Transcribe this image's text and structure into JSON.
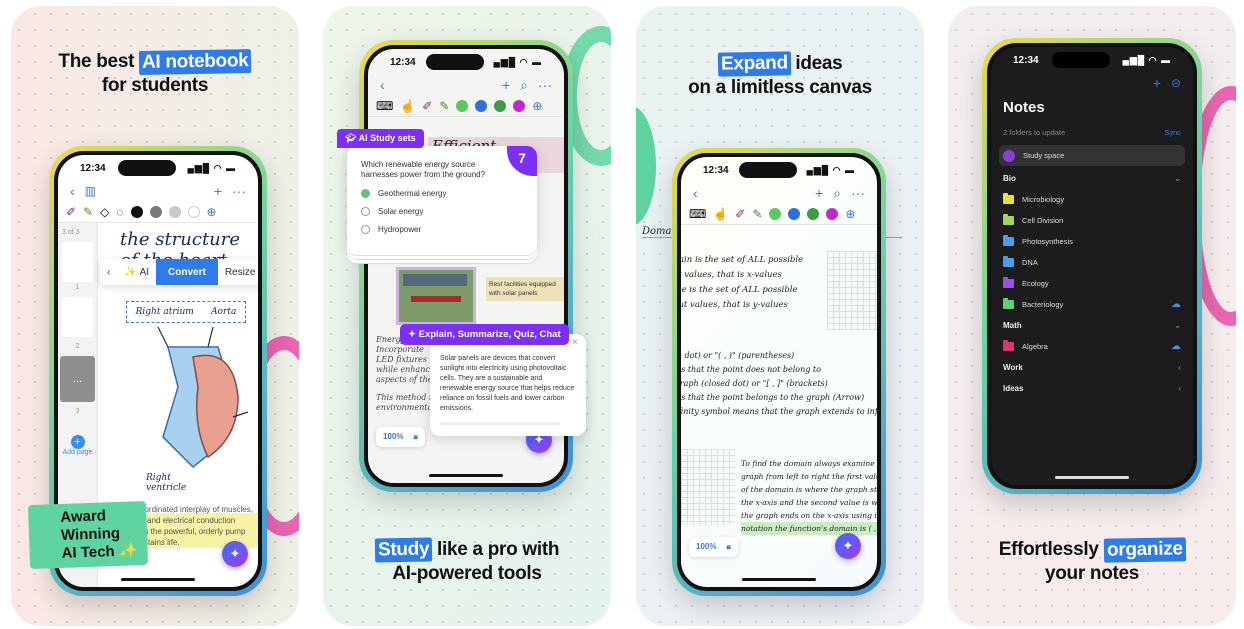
{
  "cards": [
    {
      "headline": {
        "plain_before": "The best ",
        "highlight": "AI notebook",
        "line2": "for students"
      },
      "phone": {
        "time": "12:34",
        "status_icons": "▄▆█ ◠ ▬",
        "nav": {
          "back": "‹",
          "sidebar": "▥",
          "add": "+",
          "more": "···"
        },
        "colors": [
          "#111111",
          "#7a7a7a",
          "#c8c8c8",
          "#ffffff"
        ],
        "page_indicator": "3 of 3",
        "thumb_labels": [
          "1",
          "2",
          "3"
        ],
        "add_page": "Add page",
        "context_menu": {
          "back": "‹",
          "ai": "AI",
          "convert": "Convert",
          "resize": "Resize"
        },
        "note_title": "the structure of the heart",
        "labels": [
          "Right atrium",
          "Aorta",
          "Right ventricle"
        ],
        "body_text": "The coordinated interplay of muscles, valves, and electrical conduction ensures the powerful, orderly pump that sustains life."
      },
      "award": [
        "Award",
        "Winning",
        "AI Tech ✨"
      ]
    },
    {
      "headline": {
        "highlight": "Study",
        "plain_after": " like a pro with",
        "line2": "AI-powered tools"
      },
      "phone": {
        "time": "12:34",
        "status_icons": "▄▆█ ◠ ▬",
        "nav": {
          "back": "‹",
          "add": "+",
          "search": "⌕",
          "more": "···"
        },
        "colors": [
          "#5cc85a",
          "#2f6fe0",
          "#3f9a47",
          "#c02ac8"
        ],
        "note_title": "Efficient Landscaping",
        "sticky_note": "Rest facilities equipped with solar panels",
        "hand_lines": [
          "Energy-",
          "Incorporate",
          "LED fixtures",
          "while enhancing",
          "aspects of the",
          "This method is",
          "environmental"
        ],
        "zoom_level": "100%"
      },
      "study_set": {
        "tag": "AI Study sets",
        "count": "7",
        "question": "Which renewable energy source harnesses power from the ground?",
        "options": [
          {
            "label": "Geothermal energy",
            "selected": true
          },
          {
            "label": "Solar energy",
            "selected": false
          },
          {
            "label": "Hydropower",
            "selected": false
          }
        ]
      },
      "ai_panel": {
        "tag": "Explain, Summarize, Quiz, Chat",
        "close": "×",
        "text": "Solar panels are devices that convert sunlight into electricity using photovoltaic cells. They are a sustainable and renewable energy source that helps reduce reliance on fossil fuels and lower carbon emissions."
      }
    },
    {
      "headline": {
        "highlight": "Expand",
        "plain_after": " ideas",
        "line2": "on a limitless canvas"
      },
      "phone": {
        "time": "12:34",
        "status_icons": "▄▆█ ◠ ▬",
        "nav": {
          "back": "‹",
          "add": "+",
          "search": "⌕",
          "more": "···"
        },
        "colors": [
          "#5cc85a",
          "#2f6fe0",
          "#3f9a47",
          "#c02ac8"
        ],
        "note_title": "Domain and Range of a Function's graph",
        "lines_a": [
          "Domain is the set of ALL possible",
          "input values, that is x-values",
          "Range is the set of ALL possible",
          "output values, that is y-values"
        ],
        "lines_b": [
          "(open dot) or \"( , )\" (parentheses)",
          "means that the point does not belong to",
          "the graph (closed dot) or \"[ , ]\" (brackets)",
          "means that the point belongs to the graph (Arrow)",
          "or infinity symbol means that the graph extends to infinity"
        ],
        "lines_c": [
          "To find the domain always examine your",
          "graph from left to right the first value",
          "of the domain is where the graph starts",
          "the x-axis and the second value is where",
          "the graph ends on the x-axis using interval",
          "notation the function's domain is ( , )"
        ],
        "zoom_level": "100%"
      }
    },
    {
      "headline": {
        "plain_before": "Effortlessly ",
        "highlight": "organize",
        "line2": "your notes"
      },
      "phone": {
        "time": "12:34",
        "status_icons": "▄▆█ ◠ ▬",
        "title": "Notes",
        "sync_hint": "2 folders to update",
        "sync_label": "Sync",
        "study_space": "Study space",
        "sections": [
          {
            "name": "Bio",
            "state": "⌄",
            "folders": [
              {
                "name": "Microbiology",
                "color": "#e4e23a",
                "cloud": false
              },
              {
                "name": "Cell Division",
                "color": "#a4d65e",
                "cloud": false
              },
              {
                "name": "Photosynthesis",
                "color": "#4a9eea",
                "cloud": false
              },
              {
                "name": "DNA",
                "color": "#4a9eea",
                "cloud": false
              },
              {
                "name": "Ecology",
                "color": "#9b4fe6",
                "cloud": false
              },
              {
                "name": "Bacteriology",
                "color": "#5ad27a",
                "cloud": true
              }
            ]
          },
          {
            "name": "Math",
            "state": "⌄",
            "folders": [
              {
                "name": "Algebra",
                "color": "#e0356e",
                "cloud": true
              }
            ]
          },
          {
            "name": "Work",
            "state": "‹",
            "folders": []
          },
          {
            "name": "Ideas",
            "state": "‹",
            "folders": []
          }
        ]
      }
    }
  ]
}
